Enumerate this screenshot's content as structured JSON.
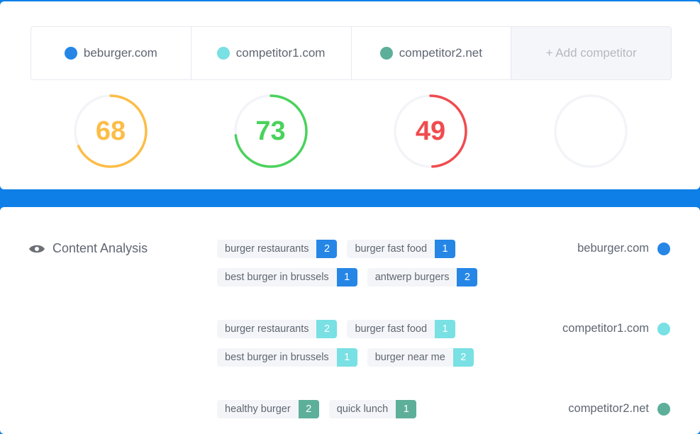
{
  "colors": {
    "primary": "#2586e6",
    "competitor1": "#79e0e4",
    "competitor2": "#5daf9a",
    "score_orange": "#fcbd47",
    "score_green": "#4ad25c",
    "score_red": "#f04b4f",
    "track": "#f3f4f8",
    "band": "#0d7fe6"
  },
  "competitors": [
    {
      "name": "beburger.com",
      "color": "#2586e6",
      "score": 68,
      "score_color": "#fcbd47"
    },
    {
      "name": "competitor1.com",
      "color": "#79e0e4",
      "score": 73,
      "score_color": "#4ad25c"
    },
    {
      "name": "competitor2.net",
      "color": "#5daf9a",
      "score": 49,
      "score_color": "#f04b4f"
    }
  ],
  "add_competitor_label": "+ Add competitor",
  "content_analysis": {
    "title": "Content Analysis",
    "icon": "eye-icon",
    "groups": [
      {
        "site": "beburger.com",
        "color": "#2586e6",
        "keywords": [
          {
            "label": "burger restaurants",
            "count": "2"
          },
          {
            "label": "burger fast food",
            "count": "1"
          },
          {
            "label": "best burger in brussels",
            "count": "1"
          },
          {
            "label": "antwerp burgers",
            "count": "2"
          }
        ]
      },
      {
        "site": "competitor1.com",
        "color": "#79e0e4",
        "keywords": [
          {
            "label": "burger restaurants",
            "count": "2"
          },
          {
            "label": "burger fast food",
            "count": "1"
          },
          {
            "label": "best burger in brussels",
            "count": "1"
          },
          {
            "label": "burger near me",
            "count": "2"
          }
        ]
      },
      {
        "site": "competitor2.net",
        "color": "#5daf9a",
        "keywords": [
          {
            "label": "healthy burger",
            "count": "2"
          },
          {
            "label": "quick lunch",
            "count": "1"
          }
        ]
      }
    ]
  }
}
